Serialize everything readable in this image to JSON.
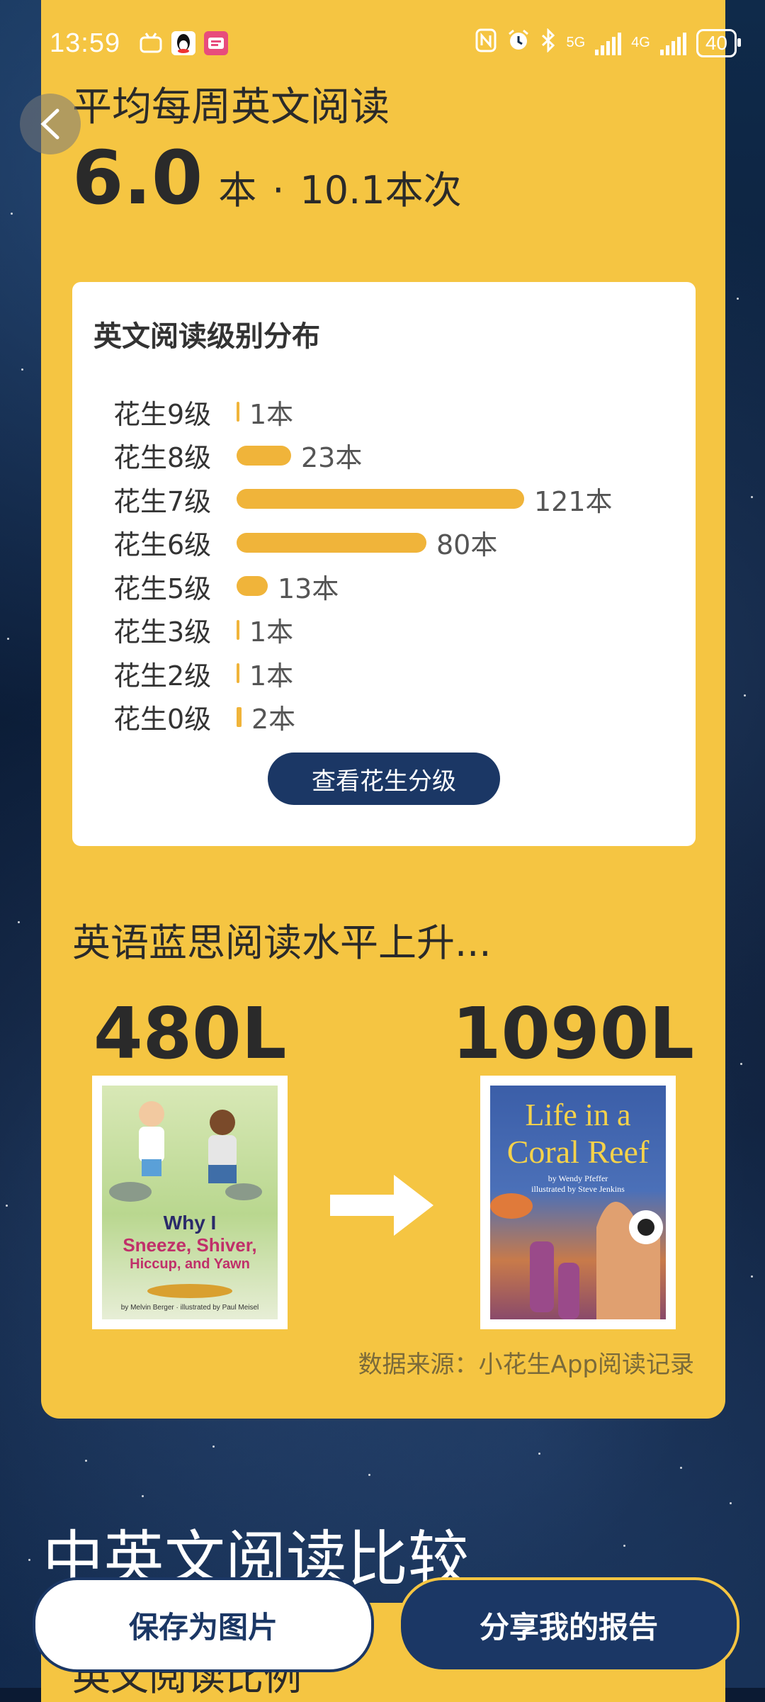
{
  "status_bar": {
    "time": "13:59",
    "network_5g": "5G",
    "network_4g": "4G",
    "battery": "40"
  },
  "summary": {
    "heading": "平均每周英文阅读",
    "books_value": "6.0",
    "books_unit": "本",
    "separator": "·",
    "sessions": "10.1本次"
  },
  "level_panel": {
    "title": "英文阅读级别分布",
    "levels": [
      {
        "label": "花生9级",
        "count": 1,
        "count_label": "1本"
      },
      {
        "label": "花生8级",
        "count": 23,
        "count_label": "23本"
      },
      {
        "label": "花生7级",
        "count": 121,
        "count_label": "121本"
      },
      {
        "label": "花生6级",
        "count": 80,
        "count_label": "80本"
      },
      {
        "label": "花生5级",
        "count": 13,
        "count_label": "13本"
      },
      {
        "label": "花生3级",
        "count": 1,
        "count_label": "1本"
      },
      {
        "label": "花生2级",
        "count": 1,
        "count_label": "1本"
      },
      {
        "label": "花生0级",
        "count": 2,
        "count_label": "2本"
      }
    ],
    "button_label": "查看花生分级"
  },
  "lexile": {
    "heading": "英语蓝思阅读水平上升...",
    "from_level": "480L",
    "to_level": "1090L",
    "from_book": {
      "title_line1": "Why I",
      "title_line2": "Sneeze, Shiver,",
      "title_line3": "Hiccup, and Yawn",
      "credit": "by Melvin Berger · illustrated by Paul Meisel"
    },
    "to_book": {
      "title_line1": "Life in a",
      "title_line2": "Coral Reef",
      "credit1": "by Wendy Pfeffer",
      "credit2": "illustrated by Steve Jenkins"
    },
    "source": "数据来源：小花生App阅读记录"
  },
  "compare": {
    "title": "中英文阅读比较",
    "subtitle": "英文阅读比例"
  },
  "actions": {
    "save_label": "保存为图片",
    "share_label": "分享我的报告"
  }
}
